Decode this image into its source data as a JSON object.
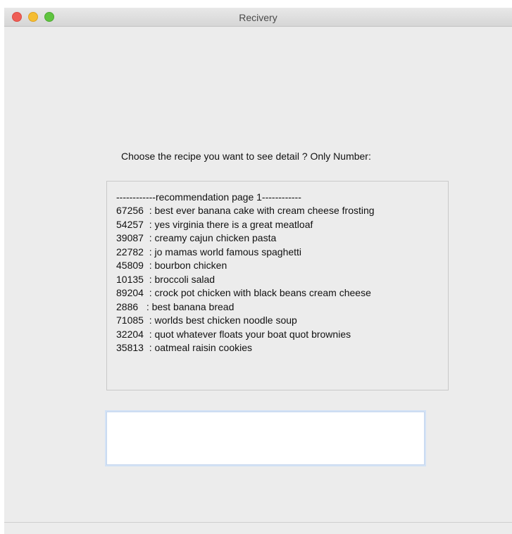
{
  "window": {
    "title": "Recivery"
  },
  "prompt": "Choose the recipe you want to see detail ? Only Number:",
  "recommendations": {
    "header": "------------recommendation page 1------------",
    "items": [
      "67256  : best ever banana cake with cream cheese frosting",
      "54257  : yes virginia there is a great meatloaf",
      "39087  : creamy cajun chicken pasta",
      "22782  : jo mamas world famous spaghetti",
      "45809  : bourbon chicken",
      "10135  : broccoli salad",
      "89204  : crock pot chicken with black beans cream cheese",
      "2886   : best banana bread",
      "71085  : worlds best chicken noodle soup",
      "32204  : quot whatever floats your boat quot brownies",
      "35813  : oatmeal raisin cookies"
    ]
  },
  "entry": {
    "value": ""
  },
  "colors": {
    "close": "#ee5e56",
    "minimize": "#f5bd32",
    "maximize": "#5fc43f",
    "background": "#ececec"
  }
}
